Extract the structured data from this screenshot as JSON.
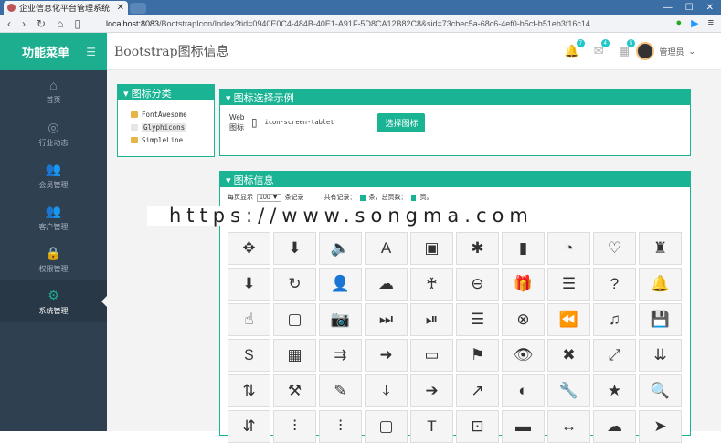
{
  "browser": {
    "tab_title": "企业信息化平台管理系统",
    "url_host": "localhost:8083",
    "url_path": "/BootstrapIcon/Index?tid=0940E0C4-484B-40E1-A91F-5D8CA12B82C8&sid=73cbec5a-68c6-4ef0-b5cf-b51eb3f16c14"
  },
  "sidebar": {
    "title": "功能菜单",
    "items": [
      {
        "label": "首页",
        "icon": "home-icon",
        "glyph": "⌂"
      },
      {
        "label": "行业动态",
        "icon": "globe-icon",
        "glyph": "◎"
      },
      {
        "label": "会员管理",
        "icon": "users-icon",
        "glyph": "👥"
      },
      {
        "label": "客户管理",
        "icon": "clients-icon",
        "glyph": "👥"
      },
      {
        "label": "权限管理",
        "icon": "lock-icon",
        "glyph": "🔒"
      },
      {
        "label": "系统管理",
        "icon": "gear-icon",
        "glyph": "⚙"
      }
    ]
  },
  "header": {
    "page_title": "Bootstrap图标信息",
    "badges": [
      "7",
      "4",
      "5"
    ],
    "user": "管理员"
  },
  "category_panel": {
    "title": "▾ 图标分类",
    "items": [
      "FontAwesome",
      "Glyphicons",
      "SimpleLine"
    ]
  },
  "example_panel": {
    "title": "▾ 图标选择示例",
    "label": "Web图标",
    "icon_name": "icon-screen-tablet",
    "button": "选择图标"
  },
  "info_panel": {
    "title": "▾ 图标信息",
    "per_page_prefix": "每页显示",
    "per_page": "100 ▼",
    "per_page_suffix": "条记录",
    "total_prefix": "共有记录：",
    "total_suffix": "条，总页数：",
    "pages_suffix": "页。"
  },
  "watermark": "https://www.songma.com",
  "icons": [
    "✥",
    "⬇",
    "🔈",
    "A",
    "▣",
    "✱",
    "▮",
    "◔",
    "♡",
    "♜",
    "⬇",
    "↻",
    "👤",
    "☁",
    "♰",
    "⊖",
    "🎁",
    "☰",
    "?",
    "🔔",
    "☝",
    "▢",
    "📷",
    "⏭",
    "⏯",
    "☰",
    "⊗",
    "⏪",
    "♫",
    "💾",
    "$",
    "▦",
    "⇉",
    "➜",
    "▭",
    "⚑",
    "👁",
    "✖",
    "⤢",
    "⇊",
    "⇅",
    "⚒",
    "✎",
    "⤓",
    "➔",
    "↗",
    "◐",
    "🔧",
    "★",
    "🔍",
    "⇵",
    "⫶",
    "⫶",
    "▢",
    "T",
    "⊡",
    "▬",
    "↔",
    "☁",
    "➤"
  ]
}
